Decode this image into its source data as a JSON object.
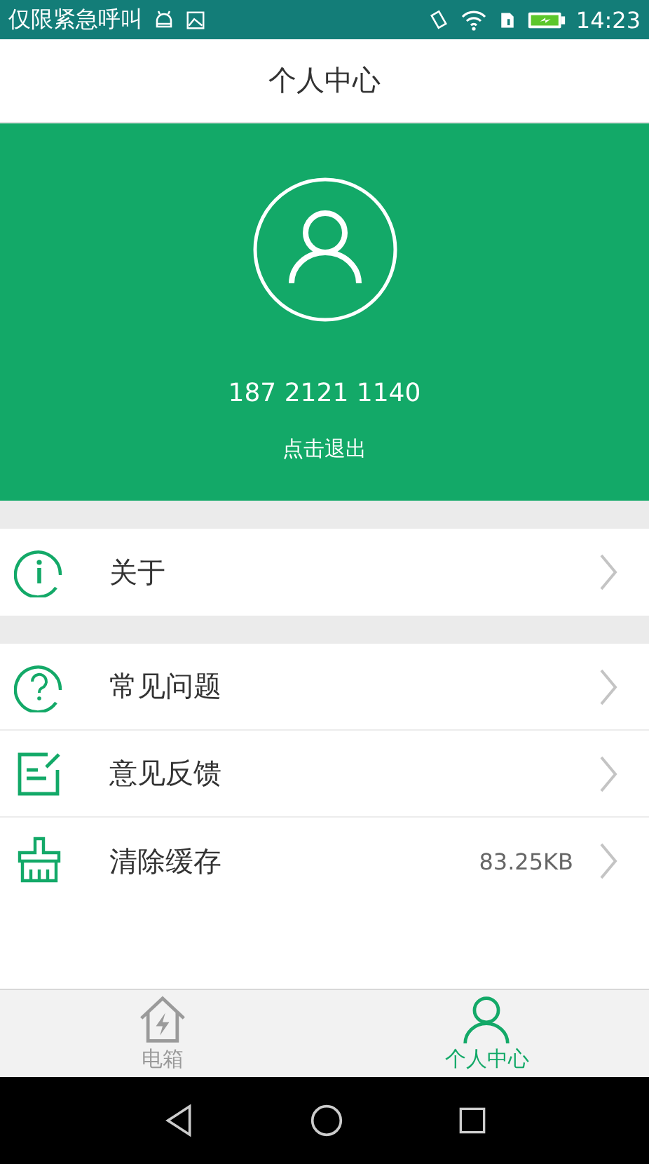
{
  "status_bar": {
    "carrier": "仅限紧急呼叫",
    "time": "14:23"
  },
  "title": "个人中心",
  "profile": {
    "phone": "187 2121 1140",
    "logout": "点击退出"
  },
  "groups": [
    [
      {
        "kind": "info",
        "label": "关于"
      }
    ],
    [
      {
        "kind": "help",
        "label": "常见问题"
      },
      {
        "kind": "edit",
        "label": "意见反馈"
      },
      {
        "kind": "clean",
        "label": "清除缓存",
        "value": "83.25KB"
      }
    ]
  ],
  "tabs": [
    {
      "kind": "home",
      "label": "电箱",
      "selected": false
    },
    {
      "kind": "person",
      "label": "个人中心",
      "selected": true
    }
  ]
}
